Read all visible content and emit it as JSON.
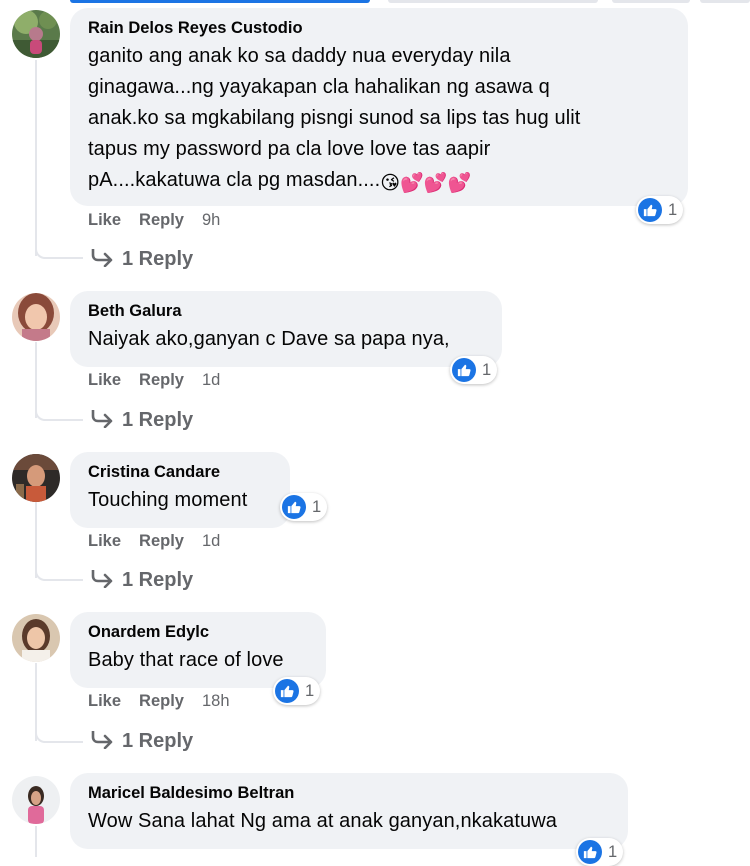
{
  "colors": {
    "accent": "#1b74e4",
    "bubble": "#f0f2f5",
    "muted": "#65676b"
  },
  "comments": [
    {
      "author": "Rain Delos Reyes Custodio",
      "lines": [
        "ganito ang anak ko sa daddy nua everyday nila",
        "ginagawa...ng yayakapan cla hahalikan ng asawa q",
        "anak.ko sa mgkabilang pisngi sunod sa lips tas hug ulit",
        "tapus my password pa cla love love tas aapir",
        "pA....kakatuwa cla pg masdan...."
      ],
      "emoji": "😘💕💕💕",
      "reaction_count": "1",
      "like": "Like",
      "reply": "Reply",
      "time": "9h",
      "replies": "1 Reply"
    },
    {
      "author": "Beth Galura",
      "lines": [
        "Naiyak ako,ganyan c Dave sa papa nya,"
      ],
      "reaction_count": "1",
      "like": "Like",
      "reply": "Reply",
      "time": "1d",
      "replies": "1 Reply"
    },
    {
      "author": "Cristina Candare",
      "lines": [
        "Touching moment"
      ],
      "reaction_count": "1",
      "like": "Like",
      "reply": "Reply",
      "time": "1d",
      "replies": "1 Reply"
    },
    {
      "author": "Onardem Edylc",
      "lines": [
        "Baby that race of love"
      ],
      "reaction_count": "1",
      "like": "Like",
      "reply": "Reply",
      "time": "18h",
      "replies": "1 Reply"
    },
    {
      "author": "Maricel Baldesimo Beltran",
      "lines": [
        "Wow Sana lahat Ng ama at anak ganyan,nkakatuwa"
      ],
      "reaction_count": "1"
    }
  ]
}
